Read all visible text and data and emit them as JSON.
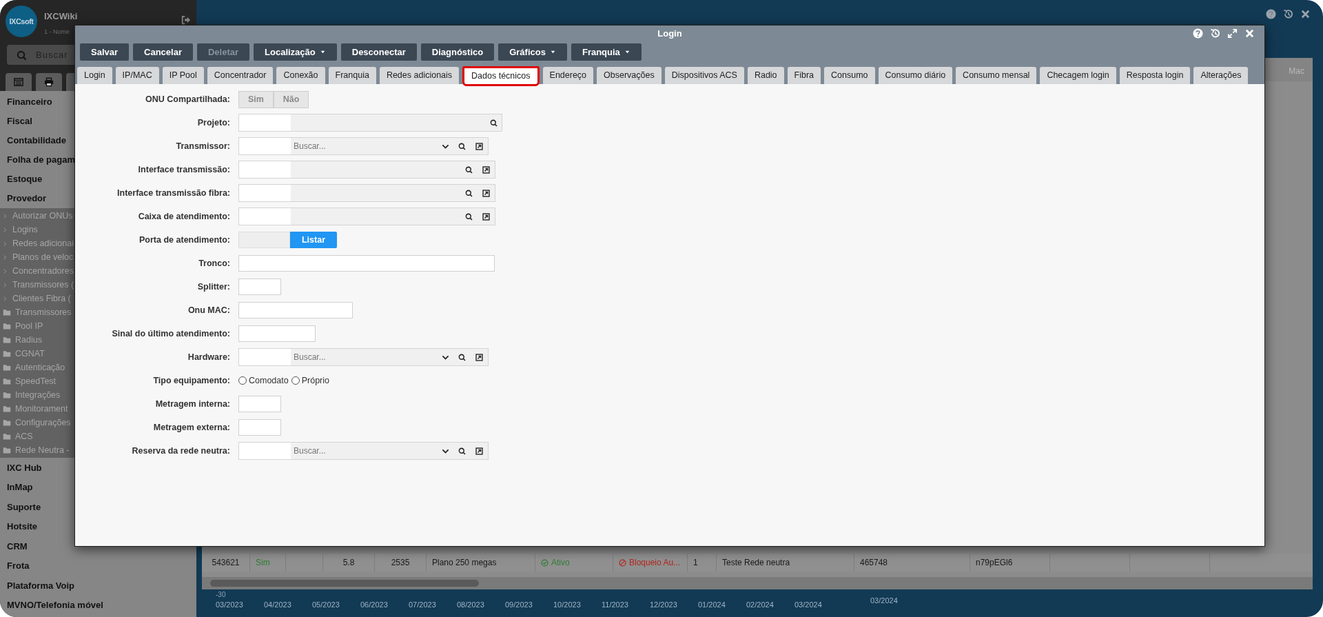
{
  "app": {
    "name": "IXCWiki",
    "subtitle": "1 - Nome",
    "logo": "IXCsoft",
    "search_placeholder": "Buscar"
  },
  "sidebar_tabs": [
    {
      "kind": "list"
    },
    {
      "kind": "printer"
    },
    {
      "kind": "blank"
    }
  ],
  "sidebar": {
    "sections_top": [
      "Financeiro",
      "Fiscal",
      "Contabilidade",
      "Folha de pagam",
      "Estoque",
      "Provedor"
    ],
    "subitems": [
      {
        "label": "Autorizar ONUs",
        "kind": "link"
      },
      {
        "label": "Logins",
        "kind": "link"
      },
      {
        "label": "Redes adicionai",
        "kind": "link"
      },
      {
        "label": "Planos de veloc",
        "kind": "link"
      },
      {
        "label": "Concentradores",
        "kind": "link"
      },
      {
        "label": "Transmissores (",
        "kind": "link"
      },
      {
        "label": "Clientes Fibra (",
        "kind": "link"
      },
      {
        "label": "Transmissores",
        "kind": "folder"
      },
      {
        "label": "Pool IP",
        "kind": "folder"
      },
      {
        "label": "Radius",
        "kind": "folder"
      },
      {
        "label": "CGNAT",
        "kind": "folder"
      },
      {
        "label": "Autenticação",
        "kind": "folder"
      },
      {
        "label": "SpeedTest",
        "kind": "folder"
      },
      {
        "label": "Integrações",
        "kind": "folder"
      },
      {
        "label": "Monitorament",
        "kind": "folder"
      },
      {
        "label": "Configurações",
        "kind": "folder"
      },
      {
        "label": "ACS",
        "kind": "folder"
      },
      {
        "label": "Rede Neutra -",
        "kind": "folder"
      }
    ],
    "sections_bottom": [
      "IXC Hub",
      "InMap",
      "Suporte",
      "Hotsite",
      "CRM",
      "Frota",
      "Plataforma Voip",
      "MVNO/Telefonia móvel"
    ]
  },
  "background": {
    "column_header": "Mac",
    "row": [
      {
        "text": "543621",
        "kind": "center"
      },
      {
        "text": "Sim",
        "kind": "green"
      },
      {
        "kind": "empty"
      },
      {
        "text": "5.8",
        "kind": "center"
      },
      {
        "text": "2535",
        "kind": "center"
      },
      {
        "text": "Plano 250 megas",
        "kind": "plain"
      },
      {
        "text": "Ativo",
        "kind": "status_ok"
      },
      {
        "text": "Bloqueio Au...",
        "kind": "status_blocked"
      },
      {
        "text": "1",
        "kind": "plain"
      },
      {
        "text": "Teste Rede neutra",
        "kind": "plain"
      },
      {
        "text": "465748",
        "kind": "plain"
      },
      {
        "text": "n79pEGl6",
        "kind": "plain"
      },
      {
        "kind": "empty"
      },
      {
        "kind": "empty"
      }
    ],
    "axis_value": "-30",
    "months": [
      "03/2023",
      "04/2023",
      "05/2023",
      "06/2023",
      "07/2023",
      "08/2023",
      "09/2023",
      "10/2023",
      "11/2023",
      "12/2023",
      "01/2024",
      "02/2024",
      "03/2024"
    ],
    "side_date": "03/2024"
  },
  "modal": {
    "title": "Login",
    "toolbar": [
      {
        "label": "Salvar",
        "dropdown": false,
        "disabled": false
      },
      {
        "label": "Cancelar",
        "dropdown": false,
        "disabled": false
      },
      {
        "label": "Deletar",
        "dropdown": false,
        "disabled": true
      },
      {
        "label": "Localização",
        "dropdown": true,
        "disabled": false
      },
      {
        "label": "Desconectar",
        "dropdown": false,
        "disabled": false
      },
      {
        "label": "Diagnóstico",
        "dropdown": false,
        "disabled": false
      },
      {
        "label": "Gráficos",
        "dropdown": true,
        "disabled": false
      },
      {
        "label": "Franquia",
        "dropdown": true,
        "disabled": false
      }
    ],
    "tabs": [
      {
        "label": "Login",
        "selected": false
      },
      {
        "label": "IP/MAC",
        "selected": false
      },
      {
        "label": "IP Pool",
        "selected": false
      },
      {
        "label": "Concentrador",
        "selected": false
      },
      {
        "label": "Conexão",
        "selected": false
      },
      {
        "label": "Franquia",
        "selected": false
      },
      {
        "label": "Redes adicionais",
        "selected": false
      },
      {
        "label": "Dados técnicos",
        "selected": true
      },
      {
        "label": "Endereço",
        "selected": false
      },
      {
        "label": "Observações",
        "selected": false
      },
      {
        "label": "Dispositivos ACS",
        "selected": false
      },
      {
        "label": "Radio",
        "selected": false
      },
      {
        "label": "Fibra",
        "selected": false
      },
      {
        "label": "Consumo",
        "selected": false
      },
      {
        "label": "Consumo diário",
        "selected": false
      },
      {
        "label": "Consumo mensal",
        "selected": false
      },
      {
        "label": "Checagem login",
        "selected": false
      },
      {
        "label": "Resposta login",
        "selected": false
      },
      {
        "label": "Alterações",
        "selected": false
      }
    ],
    "fields": [
      {
        "label": "ONU Compartilhada:",
        "kind": "toggle",
        "options": [
          {
            "label": "Sim",
            "selected": false
          },
          {
            "label": "Não",
            "selected": false
          }
        ]
      },
      {
        "label": "Projeto:",
        "kind": "lookup",
        "open_button": false
      },
      {
        "label": "Transmissor:",
        "kind": "select",
        "placeholder": "Buscar..."
      },
      {
        "label": "Interface transmissão:",
        "kind": "lookup",
        "open_button": true
      },
      {
        "label": "Interface transmissão fibra:",
        "kind": "lookup",
        "open_button": true
      },
      {
        "label": "Caixa de atendimento:",
        "kind": "lookup",
        "open_button": true
      },
      {
        "label": "Porta de atendimento:",
        "kind": "list_button",
        "button": "Listar"
      },
      {
        "label": "Tronco:",
        "kind": "text"
      },
      {
        "label": "Splitter:",
        "kind": "text"
      },
      {
        "label": "Onu MAC:",
        "kind": "text"
      },
      {
        "label": "Sinal do último atendimento:",
        "kind": "text"
      },
      {
        "label": "Hardware:",
        "kind": "select",
        "placeholder": "Buscar..."
      },
      {
        "label": "Tipo equipamento:",
        "kind": "radio",
        "options": [
          {
            "label": "Comodato",
            "selected": false
          },
          {
            "label": "Próprio",
            "selected": false
          }
        ]
      },
      {
        "label": "Metragem interna:",
        "kind": "text"
      },
      {
        "label": "Metragem externa:",
        "kind": "text"
      },
      {
        "label": "Reserva da rede neutra:",
        "kind": "select",
        "placeholder": "Buscar..."
      }
    ]
  }
}
